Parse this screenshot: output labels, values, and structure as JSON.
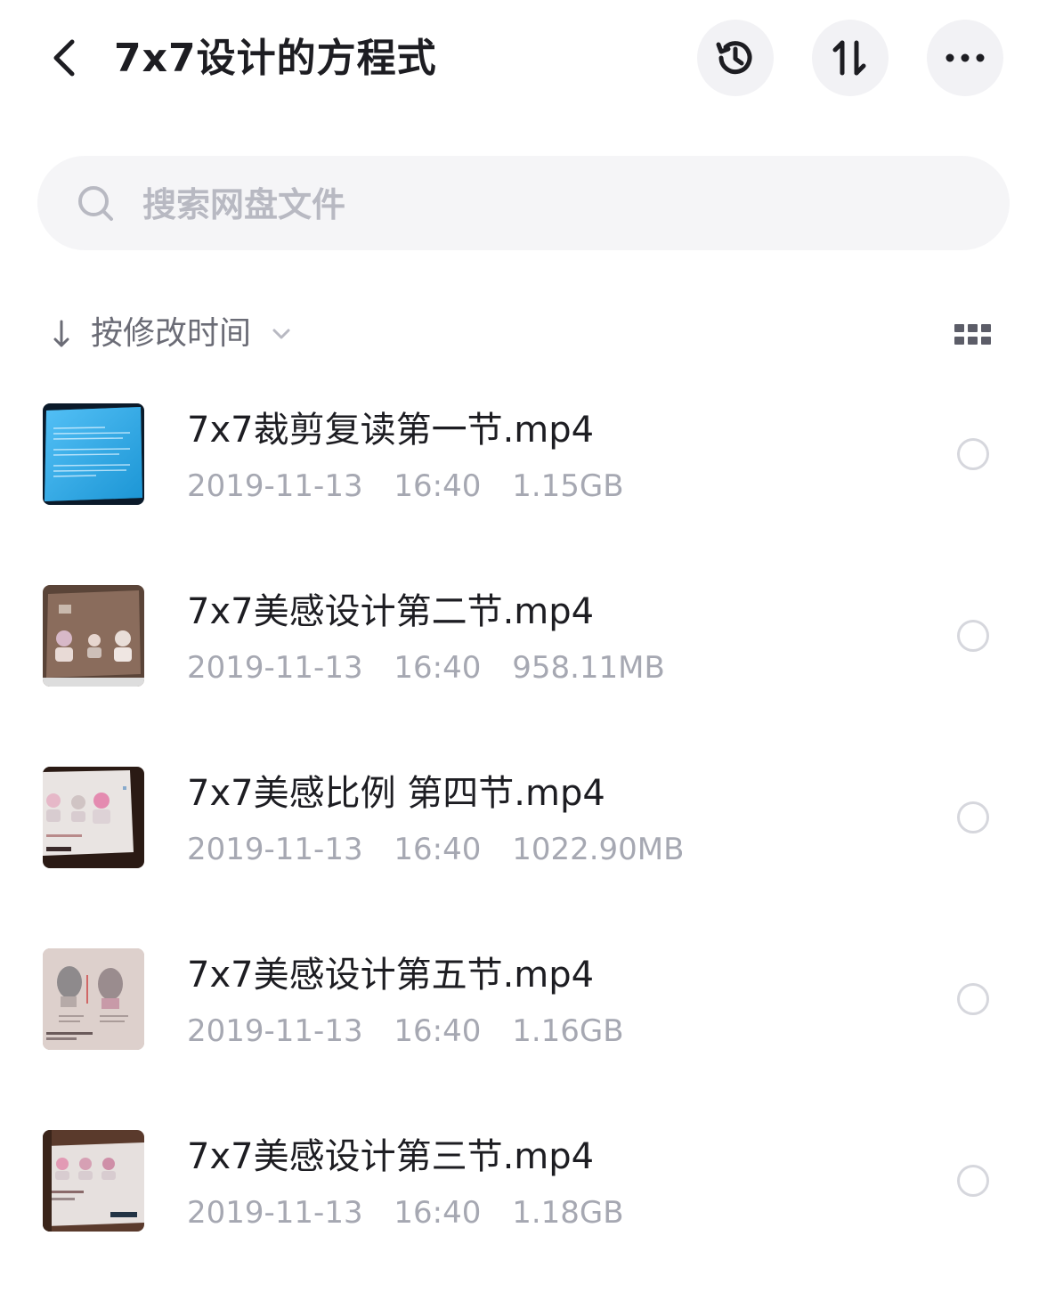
{
  "header": {
    "title": "7x7设计的方程式",
    "back_icon": "chevron-left-icon",
    "history_icon": "history-clock-icon",
    "sort_icon": "sort-arrows-icon",
    "more_icon": "more-dots-icon"
  },
  "search": {
    "placeholder": "搜索网盘文件",
    "value": ""
  },
  "sort": {
    "label": "按修改时间",
    "direction_icon": "arrow-down-icon",
    "caret_icon": "chevron-down-icon",
    "view_toggle_icon": "grid-view-icon"
  },
  "files": [
    {
      "name": "7x7裁剪复读第一节.mp4",
      "date": "2019-11-13",
      "time": "16:40",
      "size": "1.15GB"
    },
    {
      "name": "7x7美感设计第二节.mp4",
      "date": "2019-11-13",
      "time": "16:40",
      "size": "958.11MB"
    },
    {
      "name": "7x7美感比例 第四节.mp4",
      "date": "2019-11-13",
      "time": "16:40",
      "size": "1022.90MB"
    },
    {
      "name": "7x7美感设计第五节.mp4",
      "date": "2019-11-13",
      "time": "16:40",
      "size": "1.16GB"
    },
    {
      "name": "7x7美感设计第三节.mp4",
      "date": "2019-11-13",
      "time": "16:40",
      "size": "1.18GB"
    }
  ],
  "colors": {
    "title_text": "#1d1d22",
    "meta_text": "#a6a8b2",
    "placeholder": "#b8b9c2",
    "button_bg": "#f2f2f5",
    "search_bg": "#f5f5f7"
  }
}
